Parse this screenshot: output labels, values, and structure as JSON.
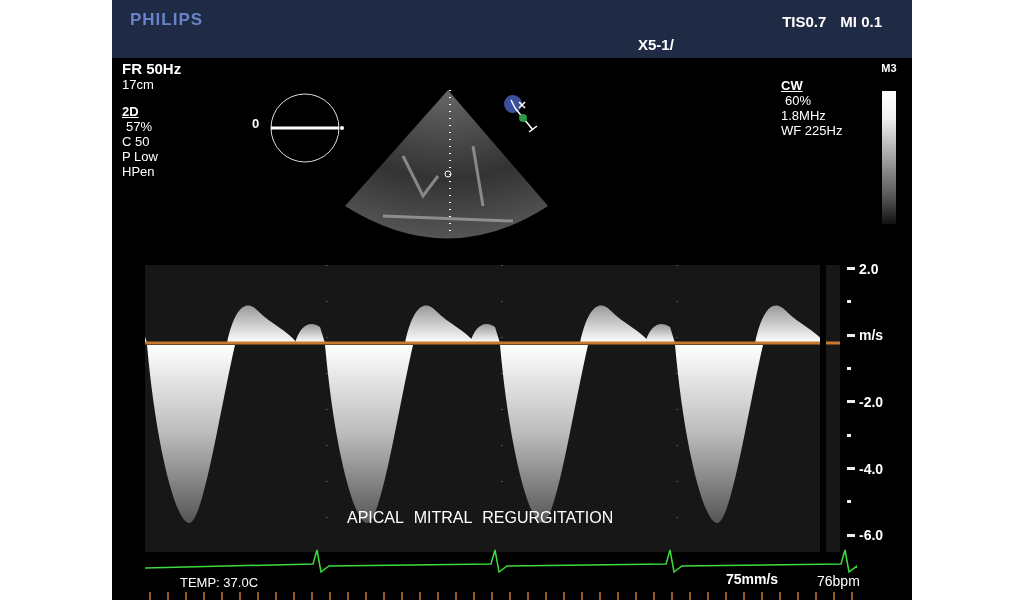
{
  "header": {
    "logo": "PHILIPS",
    "tis": "TIS0.7",
    "mi": "MI 0.1",
    "probe": "X5-1/"
  },
  "left_params": {
    "frame_rate": "FR 50Hz",
    "depth": "17cm",
    "mode": "2D",
    "items": [
      "57%",
      "C 50",
      "P Low",
      "HPen"
    ]
  },
  "orientation": {
    "angle": "0"
  },
  "right_params": {
    "mode": "CW",
    "items": [
      "60%",
      "1.8MHz",
      "WF 225Hz"
    ]
  },
  "map": {
    "label": "M3"
  },
  "doppler": {
    "caption": "APICAL MITRAL REGURGITATION",
    "sweep": "75mm/s",
    "axis": [
      {
        "kind": "label",
        "text": "2.0"
      },
      {
        "kind": "tick"
      },
      {
        "kind": "label",
        "text": "m/s"
      },
      {
        "kind": "tick"
      },
      {
        "kind": "label",
        "text": "-2.0"
      },
      {
        "kind": "tick"
      },
      {
        "kind": "label",
        "text": "-4.0"
      },
      {
        "kind": "tick"
      },
      {
        "kind": "label",
        "text": "-6.0"
      }
    ]
  },
  "footer": {
    "temp": "TEMP: 37.0C",
    "heart_rate": "76bpm"
  }
}
